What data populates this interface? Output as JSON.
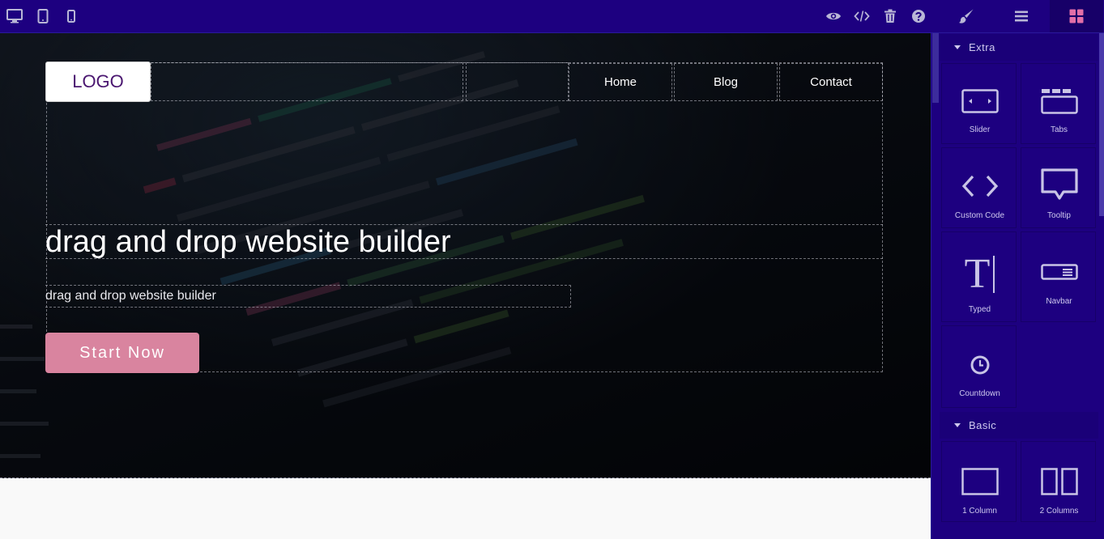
{
  "toolbar": {
    "devices": [
      "desktop",
      "tablet",
      "mobile"
    ],
    "actions": [
      "preview",
      "code",
      "delete",
      "help"
    ],
    "panels": [
      "style-manager",
      "layer-manager",
      "blocks"
    ]
  },
  "canvas": {
    "logo": "LOGO",
    "nav": [
      "Home",
      "Blog",
      "Contact"
    ],
    "title": "drag and drop website builder",
    "subtitle": "drag and drop website builder",
    "cta": "Start Now"
  },
  "blocks_panel": {
    "categories": [
      {
        "name": "Extra",
        "blocks": [
          "Slider",
          "Tabs",
          "Custom Code",
          "Tooltip",
          "Typed",
          "Navbar",
          "Countdown"
        ]
      },
      {
        "name": "Basic",
        "blocks": [
          "1 Column",
          "2 Columns"
        ]
      }
    ]
  },
  "colors": {
    "chrome": "#1d0080",
    "active_panel_icon": "#e26fa8",
    "cta_background": "#d9849f",
    "logo_text": "#4a1670"
  }
}
